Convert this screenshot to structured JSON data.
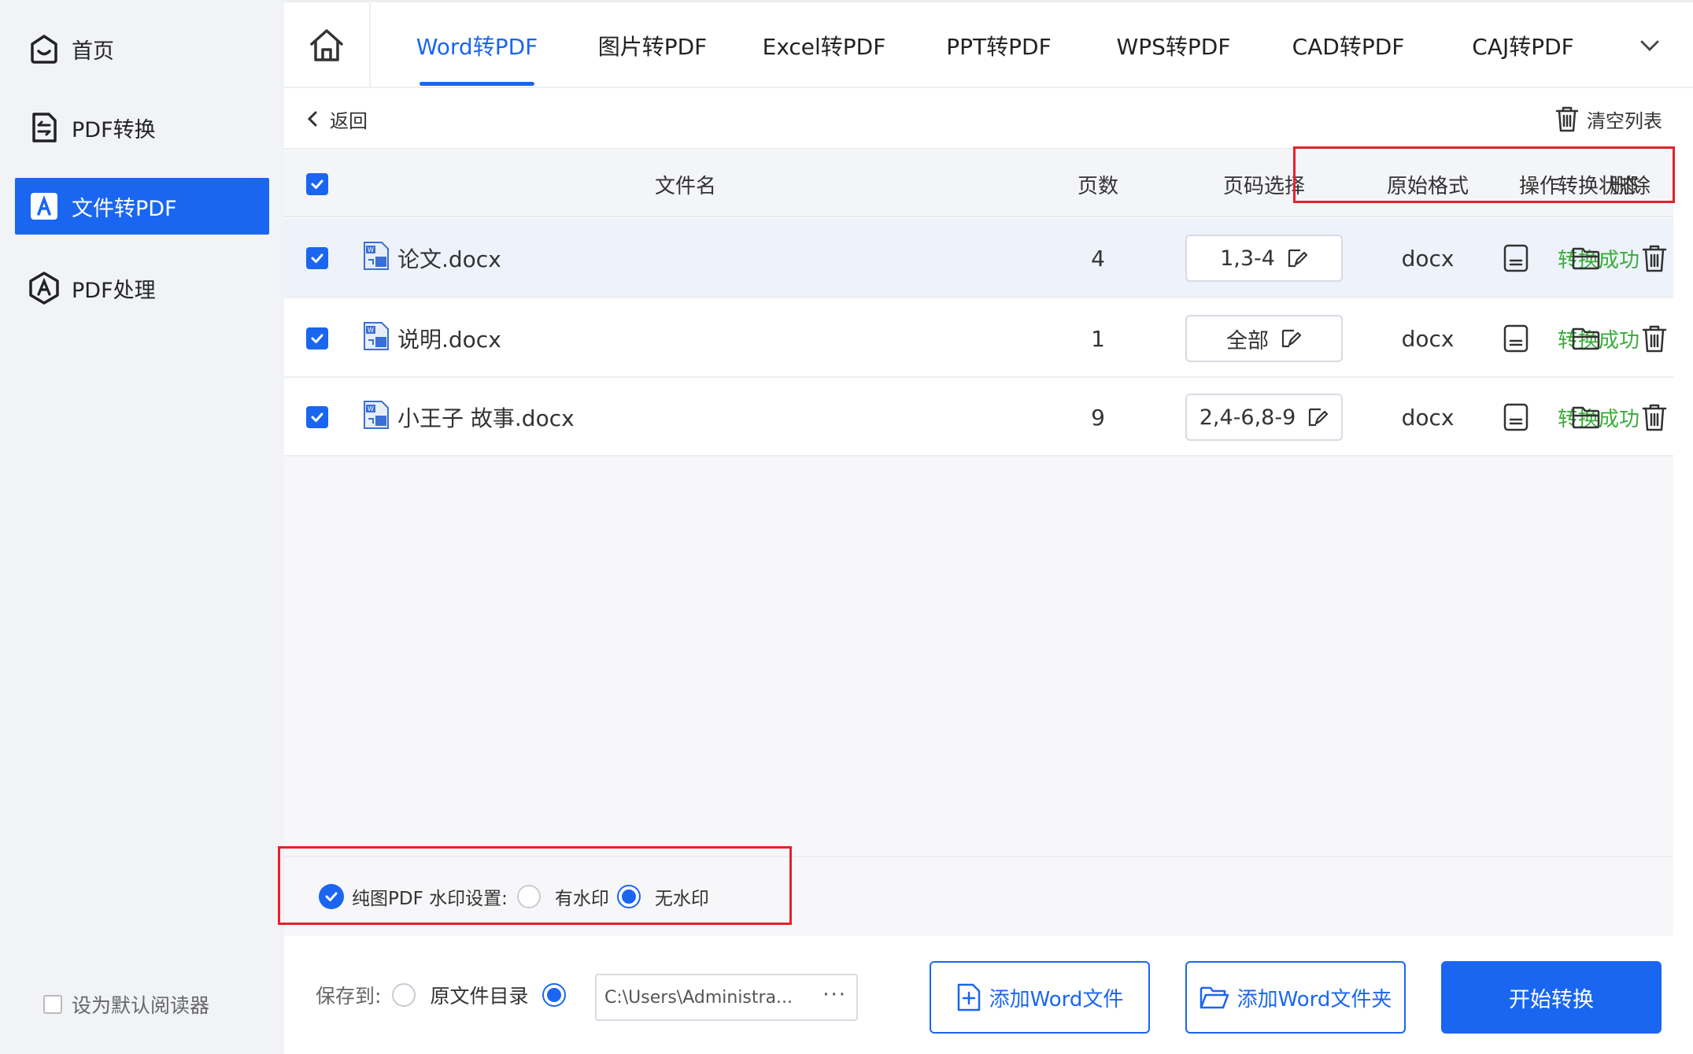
{
  "sidebar": {
    "items": [
      {
        "label": "首页",
        "icon": "home-outline-icon"
      },
      {
        "label": "PDF转换",
        "icon": "pdf-convert-icon"
      },
      {
        "label": "文件转PDF",
        "icon": "file-to-pdf-icon",
        "active": true
      },
      {
        "label": "PDF处理",
        "icon": "pdf-process-icon"
      }
    ],
    "default_reader_label": "设为默认阅读器"
  },
  "tabs": [
    {
      "label": "Word转PDF",
      "active": true
    },
    {
      "label": "图片转PDF"
    },
    {
      "label": "Excel转PDF"
    },
    {
      "label": "PPT转PDF"
    },
    {
      "label": "WPS转PDF"
    },
    {
      "label": "CAD转PDF"
    },
    {
      "label": "CAJ转PDF"
    }
  ],
  "toolbar": {
    "back_label": "返回",
    "clear_label": "清空列表"
  },
  "table": {
    "headers": {
      "filename": "文件名",
      "pages": "页数",
      "page_select": "页码选择",
      "format": "原始格式",
      "status": "转换状态",
      "actions": "操作",
      "delete": "删除"
    },
    "rows": [
      {
        "filename": "论文.docx",
        "pages": "4",
        "page_select": "1,3-4",
        "format": "docx",
        "status": "转换成功"
      },
      {
        "filename": "说明.docx",
        "pages": "1",
        "page_select": "全部",
        "format": "docx",
        "status": "转换成功"
      },
      {
        "filename": "小王子 故事.docx",
        "pages": "9",
        "page_select": "2,4-6,8-9",
        "format": "docx",
        "status": "转换成功"
      }
    ]
  },
  "watermark": {
    "label": "纯图PDF 水印设置:",
    "option_with": "有水印",
    "option_without": "无水印",
    "selected": "无水印"
  },
  "bottom": {
    "save_to_label": "保存到:",
    "original_dir_label": "原文件目录",
    "path": "C:\\Users\\Administra...",
    "path_more": "···",
    "add_file_label": "添加Word文件",
    "add_folder_label": "添加Word文件夹",
    "start_label": "开始转换"
  },
  "colors": {
    "accent": "#1a66f0",
    "success": "#3cab3c",
    "highlight_frame": "#e8202b"
  }
}
